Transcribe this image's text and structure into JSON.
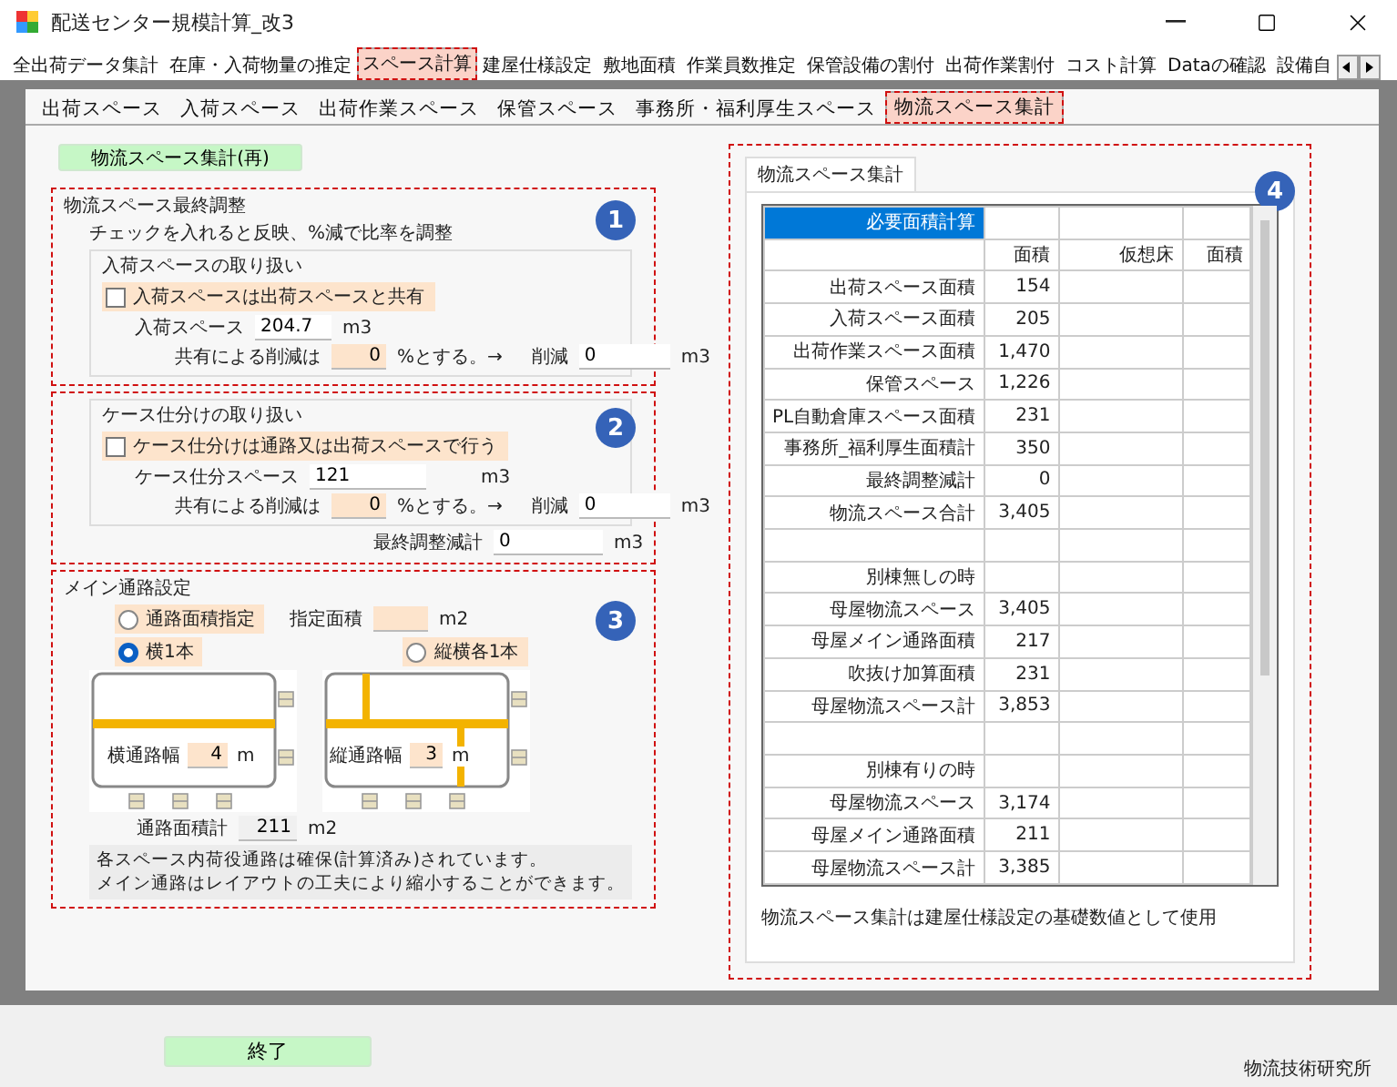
{
  "window": {
    "title": "配送センター規模計算_改3"
  },
  "main_tabs": [
    {
      "label": "全出荷データ集計",
      "selected": false,
      "highlighted": false
    },
    {
      "label": "在庫・入荷物量の推定",
      "selected": false,
      "highlighted": false
    },
    {
      "label": "スペース計算",
      "selected": true,
      "highlighted": true
    },
    {
      "label": "建屋仕様設定",
      "selected": false,
      "highlighted": false
    },
    {
      "label": "敷地面積",
      "selected": false,
      "highlighted": false
    },
    {
      "label": "作業員数推定",
      "selected": false,
      "highlighted": false
    },
    {
      "label": "保管設備の割付",
      "selected": false,
      "highlighted": false
    },
    {
      "label": "出荷作業割付",
      "selected": false,
      "highlighted": false
    },
    {
      "label": "コスト計算",
      "selected": false,
      "highlighted": false
    },
    {
      "label": "Dataの確認",
      "selected": false,
      "highlighted": false
    },
    {
      "label": "設備自",
      "selected": false,
      "highlighted": false
    }
  ],
  "sub_tabs": [
    {
      "label": "出荷スペース",
      "selected": false,
      "highlighted": false
    },
    {
      "label": "入荷スペース",
      "selected": false,
      "highlighted": false
    },
    {
      "label": "出荷作業スペース",
      "selected": false,
      "highlighted": false
    },
    {
      "label": "保管スペース",
      "selected": false,
      "highlighted": false
    },
    {
      "label": "事務所・福利厚生スペース",
      "selected": false,
      "highlighted": false
    },
    {
      "label": "物流スペース集計",
      "selected": true,
      "highlighted": true
    }
  ],
  "recalc_button": "物流スペース集計(再)",
  "final_adjust": {
    "badge": "1",
    "title": "物流スペース最終調整",
    "note": "チェックを入れると反映、%減で比率を調整",
    "inbound": {
      "title": "入荷スペースの取り扱い",
      "checkbox": {
        "label": "入荷スペースは出荷スペースと共有",
        "checked": false
      },
      "space_label": "入荷スペース",
      "space_value": "204.7",
      "space_unit": "m3",
      "share_label": "共有による削減は",
      "share_value": "0",
      "share_suffix": "%とする。→",
      "reduce_label": "削減",
      "reduce_value": "0",
      "reduce_unit": "m3"
    }
  },
  "case_sort": {
    "badge": "2",
    "title": "ケース仕分けの取り扱い",
    "checkbox": {
      "label": "ケース仕分けは通路又は出荷スペースで行う",
      "checked": false
    },
    "space_label": "ケース仕分スペース",
    "space_value": "121",
    "space_unit": "m3",
    "share_label": "共有による削減は",
    "share_value": "0",
    "share_suffix": "%とする。→",
    "reduce_label": "削減",
    "reduce_value": "0",
    "reduce_unit": "m3",
    "total_label": "最終調整減計",
    "total_value": "0",
    "total_unit": "m3"
  },
  "main_aisle": {
    "badge": "3",
    "title": "メイン通路設定",
    "options": [
      {
        "label": "通路面積指定",
        "selected": false
      },
      {
        "label": "横1本",
        "selected": true
      },
      {
        "label": "縦横各1本",
        "selected": false
      }
    ],
    "area_label": "指定面積",
    "area_unit": "m2",
    "horizontal": {
      "label": "横通路幅",
      "value": "4",
      "unit": "m"
    },
    "vertical": {
      "label": "縦通路幅",
      "value": "3",
      "unit": "m"
    },
    "total_label": "通路面積計",
    "total_value": "211",
    "total_unit": "m2",
    "note": [
      "各スペース内荷役通路は確保(計算済み)されています。",
      "メイン通路はレイアウトの工夫により縮小することができます。"
    ]
  },
  "summary": {
    "badge": "4",
    "tab": "物流スペース集計",
    "corner": "必要面積計算",
    "columns": [
      "面積",
      "仮想床",
      "面積"
    ],
    "rows": [
      {
        "kind": "data",
        "label": "出荷スペース面積",
        "value": "154"
      },
      {
        "kind": "data",
        "label": "入荷スペース面積",
        "value": "205"
      },
      {
        "kind": "data",
        "label": "出荷作業スペース面積",
        "value": "1,470"
      },
      {
        "kind": "data",
        "label": "保管スペース",
        "value": "1,226"
      },
      {
        "kind": "data",
        "label": "PL自動倉庫スペース面積",
        "value": "231"
      },
      {
        "kind": "data",
        "label": "事務所_福利厚生面積計",
        "value": "350"
      },
      {
        "kind": "data",
        "label": "最終調整減計",
        "value": "0"
      },
      {
        "kind": "data",
        "label": "物流スペース合計",
        "value": "3,405"
      },
      {
        "kind": "blank"
      },
      {
        "kind": "heading",
        "label": "別棟無しの時"
      },
      {
        "kind": "data",
        "label": "母屋物流スペース",
        "value": "3,405"
      },
      {
        "kind": "data",
        "label": "母屋メイン通路面積",
        "value": "217"
      },
      {
        "kind": "data",
        "label": "吹抜け加算面積",
        "value": "231"
      },
      {
        "kind": "data",
        "label": "母屋物流スペース計",
        "value": "3,853"
      },
      {
        "kind": "blank"
      },
      {
        "kind": "heading",
        "label": "別棟有りの時"
      },
      {
        "kind": "data",
        "label": "母屋物流スペース",
        "value": "3,174"
      },
      {
        "kind": "data",
        "label": "母屋メイン通路面積",
        "value": "211"
      },
      {
        "kind": "data",
        "label": "母屋物流スペース計",
        "value": "3,385"
      }
    ],
    "footer": "物流スペース集計は建屋仕様設定の基礎数値として使用"
  },
  "exit_button": "終了",
  "company": "物流技術研究所"
}
